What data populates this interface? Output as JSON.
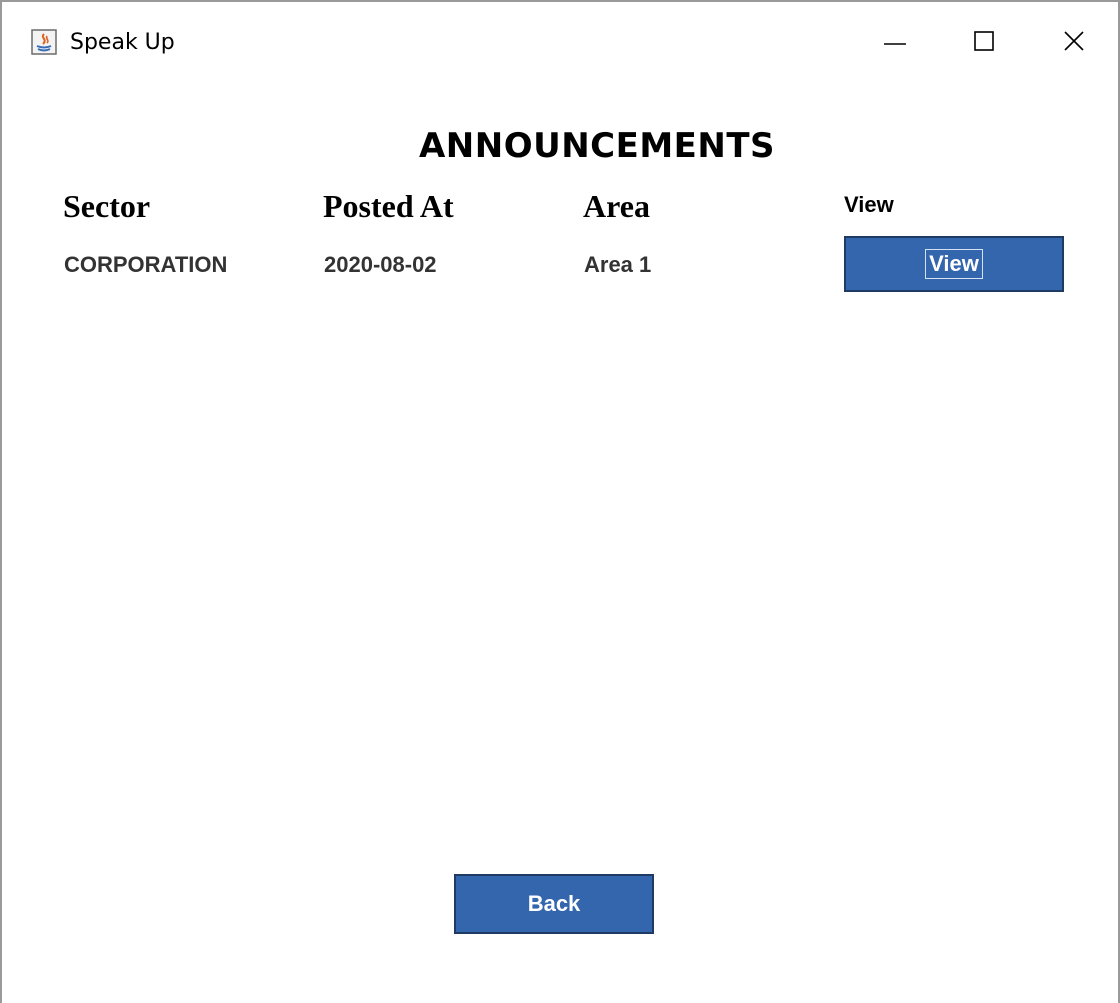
{
  "window": {
    "title": "Speak Up",
    "icons": {
      "app": "java-app-icon",
      "minimize": "minimize-icon",
      "maximize": "maximize-icon",
      "close": "close-icon"
    }
  },
  "page": {
    "title": "ANNOUNCEMENTS"
  },
  "table": {
    "headers": [
      "Sector",
      "Posted At",
      "Area",
      "View"
    ],
    "rows": [
      {
        "sector": "CORPORATION",
        "posted_at": "2020-08-02",
        "area": "Area 1",
        "view_label": "View"
      }
    ]
  },
  "actions": {
    "back_label": "Back"
  },
  "colors": {
    "button_bg": "#3466ae",
    "button_border": "#1f3a63",
    "button_text": "#ffffff"
  }
}
